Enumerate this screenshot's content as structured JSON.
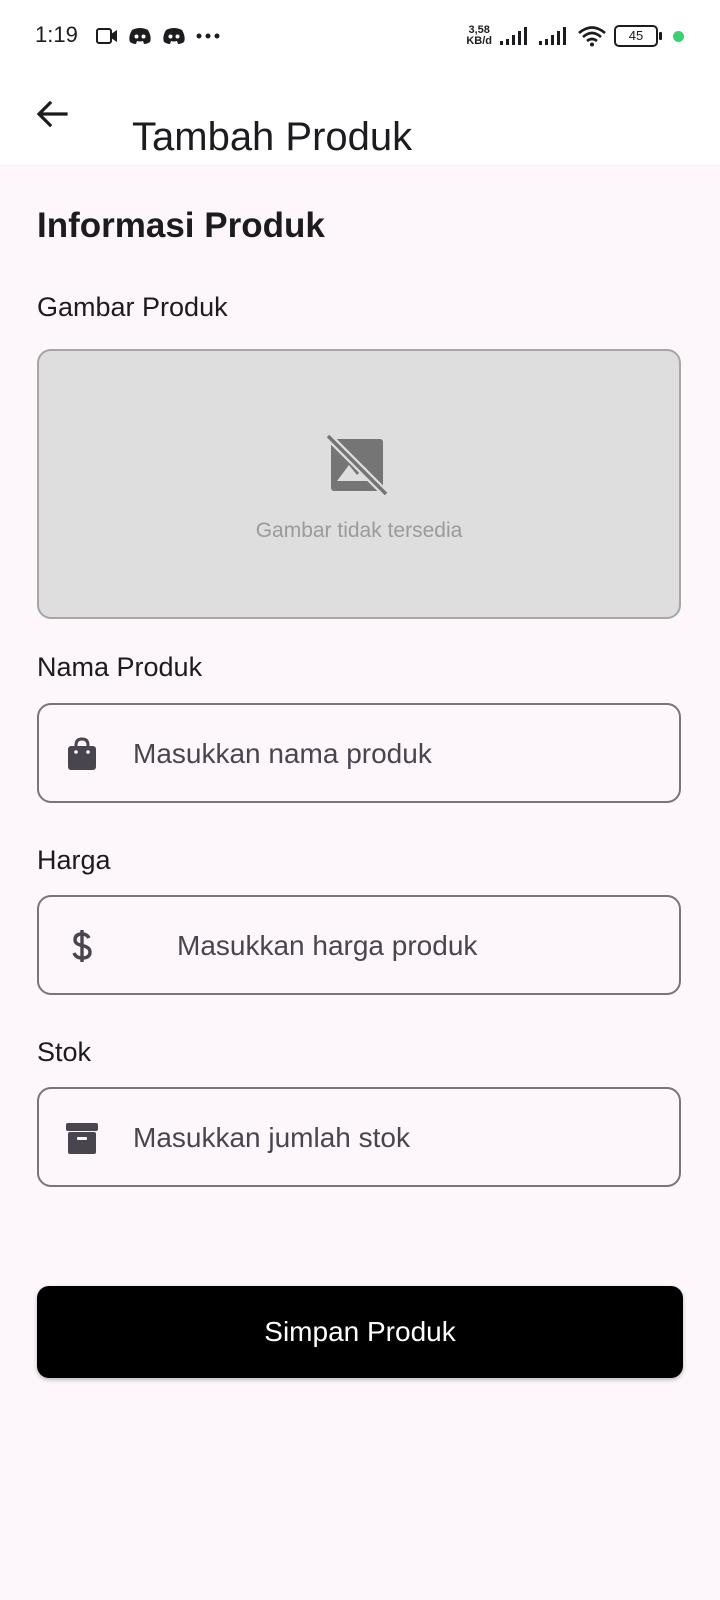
{
  "status_bar": {
    "time": "1:19",
    "net_speed_value": "3,58",
    "net_speed_unit": "KB/d",
    "battery": "45",
    "icons": [
      "video-icon",
      "discord-icon",
      "discord-icon",
      "more-icon",
      "signal-icon",
      "signal-icon",
      "wifi-icon",
      "battery-icon"
    ]
  },
  "app_bar": {
    "title": "Tambah Produk",
    "back_icon": "arrow-back-icon"
  },
  "form": {
    "section_title": "Informasi Produk",
    "image": {
      "label": "Gambar Produk",
      "placeholder_caption": "Gambar tidak tersedia",
      "icon": "image-not-supported-icon"
    },
    "name": {
      "label": "Nama Produk",
      "placeholder": "Masukkan nama produk",
      "value": "",
      "icon": "shopping-bag-icon"
    },
    "price": {
      "label": "Harga",
      "placeholder": "Masukkan harga produk",
      "value": "",
      "icon": "dollar-icon"
    },
    "stock": {
      "label": "Stok",
      "placeholder": "Masukkan jumlah stok",
      "value": "",
      "icon": "archive-icon"
    },
    "submit_label": "Simpan Produk"
  },
  "colors": {
    "background": "#fdf7fc",
    "appbar": "#ffffff",
    "button": "#000000",
    "button_text": "#ffffff",
    "input_border": "#79747e",
    "image_box": "#dedede",
    "status_dot": "#3bd16f"
  }
}
